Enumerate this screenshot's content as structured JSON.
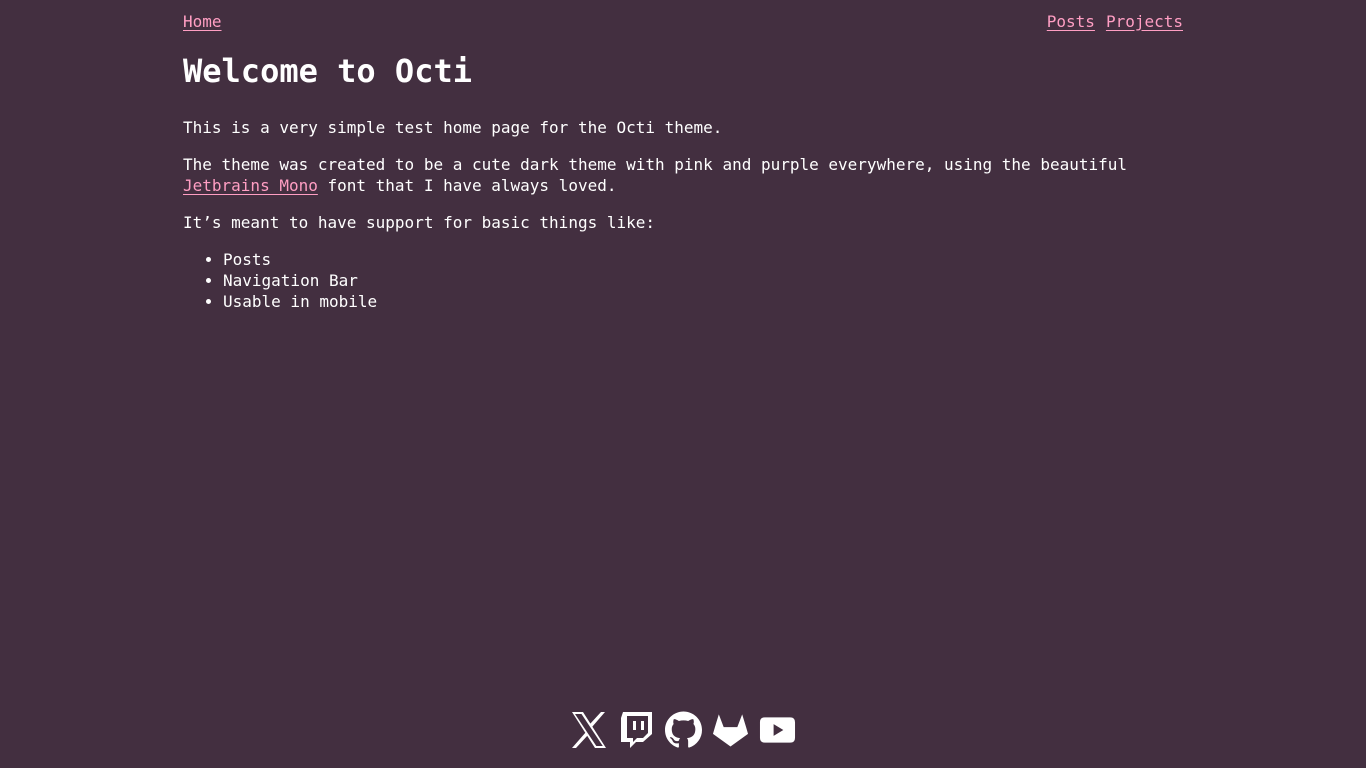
{
  "nav": {
    "home": "Home",
    "posts": "Posts",
    "projects": "Projects"
  },
  "page": {
    "title": "Welcome to Octi",
    "p1": "This is a very simple test home page for the Octi theme.",
    "p2_before": "The theme was created to be a cute dark theme with pink and purple everywhere, using the beautiful ",
    "p2_link": "Jetbrains Mono",
    "p2_after": " font that I have always loved.",
    "p3": "It’s meant to have support for basic things like:",
    "list": [
      "Posts",
      "Navigation Bar",
      "Usable in mobile"
    ]
  },
  "footer": {
    "icons": [
      "x-icon",
      "twitch-icon",
      "github-icon",
      "gitlab-icon",
      "youtube-icon"
    ]
  },
  "colors": {
    "background": "#432f40",
    "text": "#ffffff",
    "link": "#ff9ec3"
  }
}
